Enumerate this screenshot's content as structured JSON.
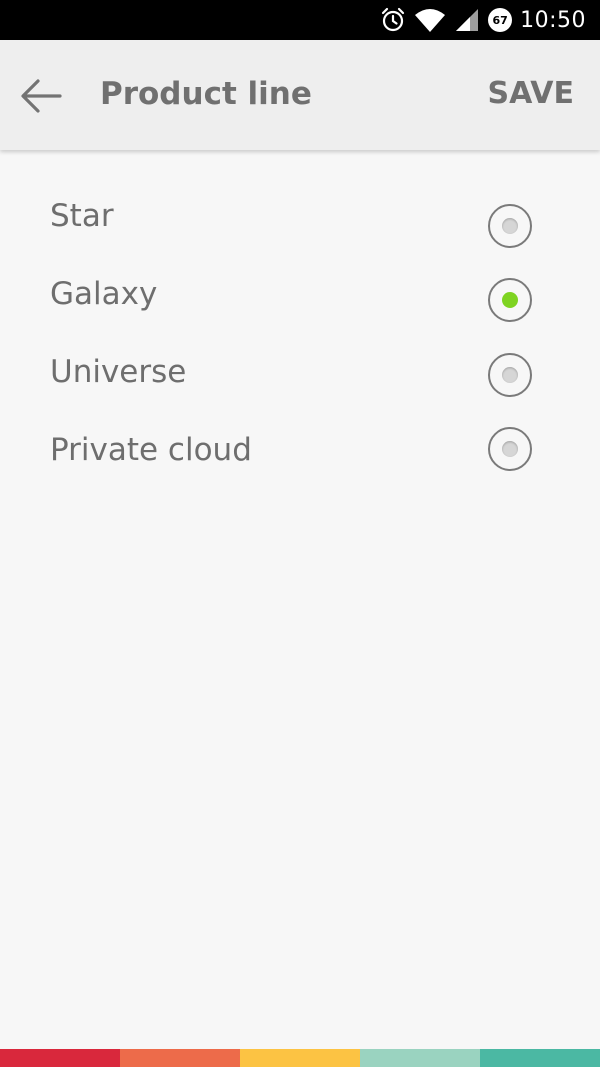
{
  "status_bar": {
    "time": "10:50",
    "battery_level": "67",
    "icons": [
      "alarm-icon",
      "wifi-icon",
      "cell-signal-icon",
      "battery-icon"
    ]
  },
  "app_bar": {
    "back_icon": "arrow-back-icon",
    "title": "Product line",
    "save_label": "SAVE"
  },
  "options": [
    {
      "label": "Star",
      "selected": false
    },
    {
      "label": "Galaxy",
      "selected": true
    },
    {
      "label": "Universe",
      "selected": false
    },
    {
      "label": "Private cloud",
      "selected": false
    }
  ],
  "colors": {
    "accent": "#7ed321",
    "strip": [
      "#d9283c",
      "#ed6b4a",
      "#fcc343",
      "#9ad3c0",
      "#4bb8a3"
    ]
  }
}
